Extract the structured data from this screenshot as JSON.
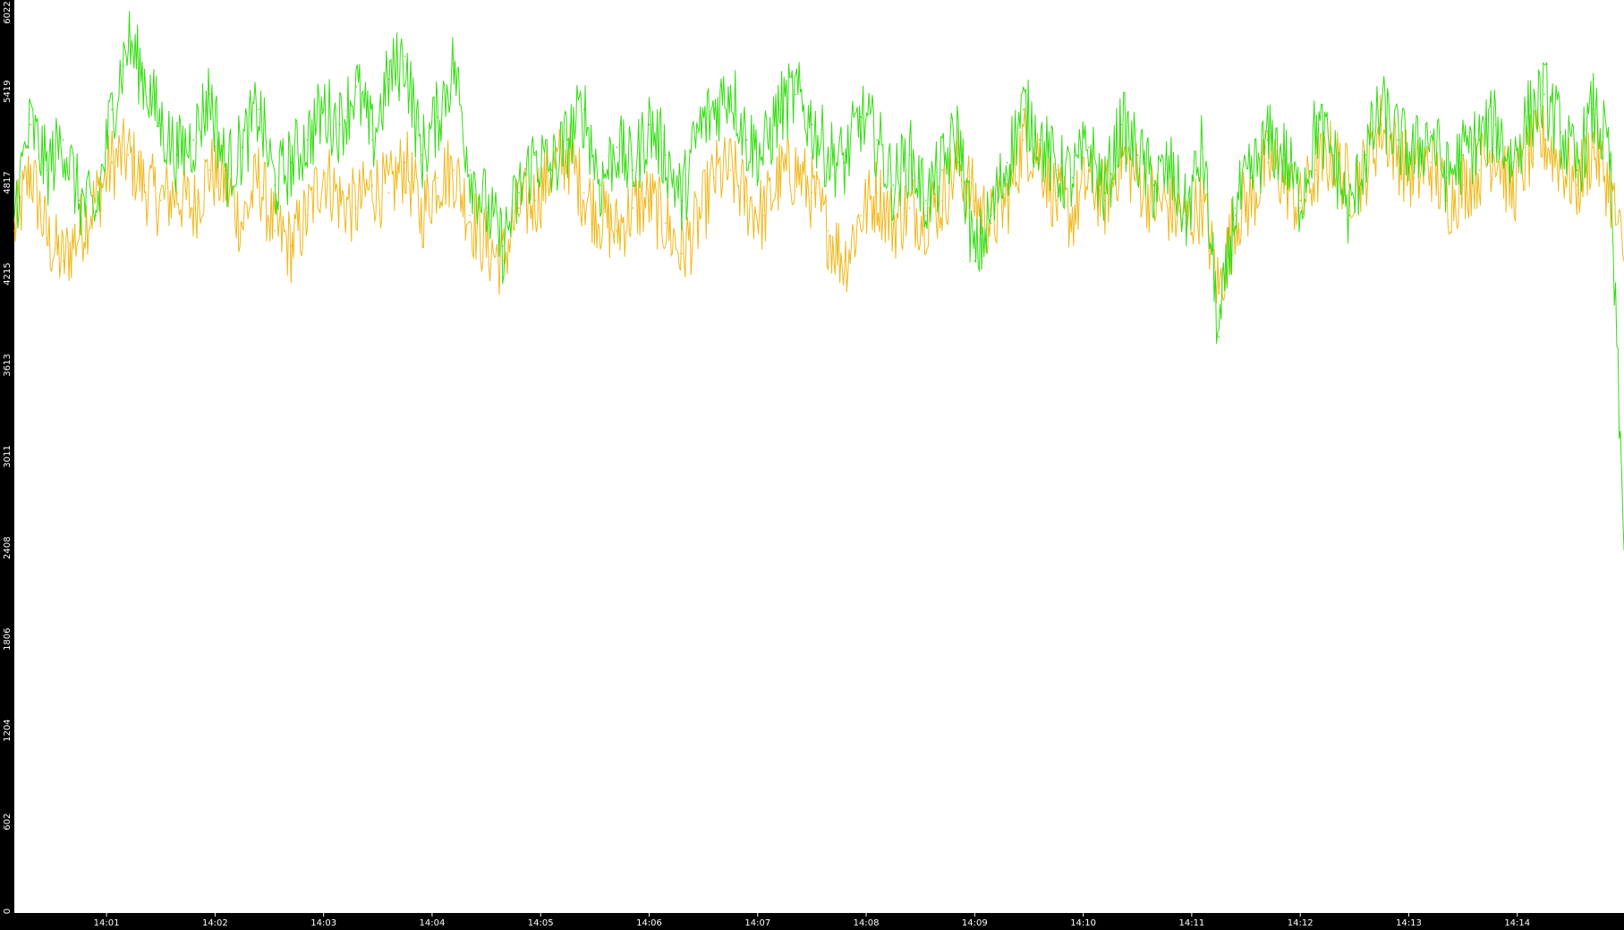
{
  "chart_data": {
    "type": "line",
    "title": "",
    "xlabel": "",
    "ylabel": "",
    "ylim": [
      0,
      6022
    ],
    "y_ticks": [
      "0",
      "602",
      "1204",
      "1806",
      "2408",
      "3011",
      "3613",
      "4215",
      "4817",
      "5419",
      "6022"
    ],
    "x_tick_labels": [
      "14:01",
      "14:02",
      "14:03",
      "14:04",
      "14:05",
      "14:06",
      "14:07",
      "14:08",
      "14:09",
      "14:10",
      "14:11",
      "14:12",
      "14:13",
      "14:14"
    ],
    "x_range": [
      "14:00:09",
      "14:14:59"
    ],
    "grid": false,
    "legend": "none",
    "background": "#ffffff",
    "axis_background": "#000000",
    "series": [
      {
        "color": "#33dd11",
        "x": [
          "14:00:09",
          "14:00:18",
          "14:00:27",
          "14:00:36",
          "14:00:45",
          "14:00:54",
          "14:01:03",
          "14:01:12",
          "14:01:21",
          "14:01:30",
          "14:01:39",
          "14:01:48",
          "14:01:57",
          "14:02:06",
          "14:02:15",
          "14:02:24",
          "14:02:33",
          "14:02:42",
          "14:02:51",
          "14:03:00",
          "14:03:09",
          "14:03:18",
          "14:03:27",
          "14:03:36",
          "14:03:45",
          "14:03:54",
          "14:04:03",
          "14:04:12",
          "14:04:21",
          "14:04:30",
          "14:04:39",
          "14:04:48",
          "14:04:57",
          "14:05:06",
          "14:05:15",
          "14:05:24",
          "14:05:33",
          "14:05:42",
          "14:05:51",
          "14:06:00",
          "14:06:09",
          "14:06:18",
          "14:06:27",
          "14:06:36",
          "14:06:45",
          "14:06:54",
          "14:07:03",
          "14:07:12",
          "14:07:21",
          "14:07:30",
          "14:07:39",
          "14:07:48",
          "14:07:57",
          "14:08:06",
          "14:08:15",
          "14:08:24",
          "14:08:33",
          "14:08:42",
          "14:08:51",
          "14:09:00",
          "14:09:09",
          "14:09:18",
          "14:09:27",
          "14:09:36",
          "14:09:45",
          "14:09:54",
          "14:10:03",
          "14:10:12",
          "14:10:21",
          "14:10:30",
          "14:10:39",
          "14:10:48",
          "14:10:57",
          "14:11:06",
          "14:11:15",
          "14:11:24",
          "14:11:33",
          "14:11:42",
          "14:11:51",
          "14:12:00",
          "14:12:09",
          "14:12:18",
          "14:12:27",
          "14:12:36",
          "14:12:45",
          "14:12:54",
          "14:13:03",
          "14:13:12",
          "14:13:21",
          "14:13:30",
          "14:13:39",
          "14:13:48",
          "14:13:57",
          "14:14:06",
          "14:14:15",
          "14:14:24",
          "14:14:33",
          "14:14:42",
          "14:14:51",
          "14:14:59"
        ],
        "values": [
          4650,
          5200,
          4900,
          5100,
          4700,
          4600,
          5300,
          5750,
          5500,
          5200,
          5000,
          5100,
          5400,
          4900,
          5050,
          5300,
          4800,
          4950,
          5100,
          5300,
          5200,
          5450,
          5100,
          5500,
          5650,
          5000,
          5250,
          5600,
          4900,
          4650,
          4400,
          4750,
          5000,
          4900,
          5100,
          5300,
          4800,
          5050,
          4900,
          5200,
          5000,
          4700,
          5150,
          5300,
          5450,
          5100,
          5000,
          5300,
          5400,
          5200,
          5000,
          4950,
          5250,
          5100,
          4800,
          5000,
          4700,
          4900,
          5150,
          4300,
          4600,
          4950,
          5300,
          5100,
          4900,
          4850,
          5050,
          4750,
          5200,
          5000,
          4800,
          4900,
          4600,
          5050,
          3800,
          4650,
          4850,
          5100,
          5000,
          4700,
          5200,
          5000,
          4600,
          5000,
          5300,
          5100,
          5000,
          5150,
          4850,
          5000,
          5100,
          5200,
          4950,
          5250,
          5400,
          5150,
          4900,
          5300,
          5000,
          2400
        ]
      },
      {
        "color": "#f0b81c",
        "x": [
          "14:00:09",
          "14:00:18",
          "14:00:27",
          "14:00:36",
          "14:00:45",
          "14:00:54",
          "14:01:03",
          "14:01:12",
          "14:01:21",
          "14:01:30",
          "14:01:39",
          "14:01:48",
          "14:01:57",
          "14:02:06",
          "14:02:15",
          "14:02:24",
          "14:02:33",
          "14:02:42",
          "14:02:51",
          "14:03:00",
          "14:03:09",
          "14:03:18",
          "14:03:27",
          "14:03:36",
          "14:03:45",
          "14:03:54",
          "14:04:03",
          "14:04:12",
          "14:04:21",
          "14:04:30",
          "14:04:39",
          "14:04:48",
          "14:04:57",
          "14:05:06",
          "14:05:15",
          "14:05:24",
          "14:05:33",
          "14:05:42",
          "14:05:51",
          "14:06:00",
          "14:06:09",
          "14:06:18",
          "14:06:27",
          "14:06:36",
          "14:06:45",
          "14:06:54",
          "14:07:03",
          "14:07:12",
          "14:07:21",
          "14:07:30",
          "14:07:39",
          "14:07:48",
          "14:07:57",
          "14:08:06",
          "14:08:15",
          "14:08:24",
          "14:08:33",
          "14:08:42",
          "14:08:51",
          "14:09:00",
          "14:09:09",
          "14:09:18",
          "14:09:27",
          "14:09:36",
          "14:09:45",
          "14:09:54",
          "14:10:03",
          "14:10:12",
          "14:10:21",
          "14:10:30",
          "14:10:39",
          "14:10:48",
          "14:10:57",
          "14:11:06",
          "14:11:15",
          "14:11:24",
          "14:11:33",
          "14:11:42",
          "14:11:51",
          "14:12:00",
          "14:12:09",
          "14:12:18",
          "14:12:27",
          "14:12:36",
          "14:12:45",
          "14:12:54",
          "14:13:03",
          "14:13:12",
          "14:13:21",
          "14:13:30",
          "14:13:39",
          "14:13:48",
          "14:13:57",
          "14:14:06",
          "14:14:15",
          "14:14:24",
          "14:14:33",
          "14:14:42",
          "14:14:51",
          "14:14:59"
        ],
        "values": [
          4500,
          4900,
          4450,
          4300,
          4500,
          4700,
          4950,
          5000,
          4800,
          4700,
          4750,
          4650,
          4900,
          4800,
          4550,
          4850,
          4500,
          4400,
          4600,
          4900,
          4700,
          4650,
          4800,
          4750,
          4950,
          4600,
          4850,
          4900,
          4600,
          4400,
          4300,
          4650,
          4700,
          4900,
          5000,
          4750,
          4600,
          4500,
          4650,
          4700,
          4550,
          4350,
          4550,
          4850,
          4900,
          4700,
          4600,
          4850,
          4900,
          4750,
          4500,
          4300,
          4600,
          4750,
          4550,
          4650,
          4600,
          4700,
          4950,
          4700,
          4550,
          4700,
          5100,
          5000,
          4700,
          4600,
          4850,
          4700,
          5000,
          4850,
          4700,
          4650,
          4550,
          4700,
          4100,
          4600,
          4700,
          4950,
          4850,
          4650,
          4900,
          5000,
          4800,
          4900,
          5200,
          5000,
          4850,
          4950,
          4700,
          4800,
          4900,
          5050,
          4750,
          5000,
          5100,
          4950,
          4800,
          5050,
          4800,
          4300
        ]
      }
    ]
  }
}
